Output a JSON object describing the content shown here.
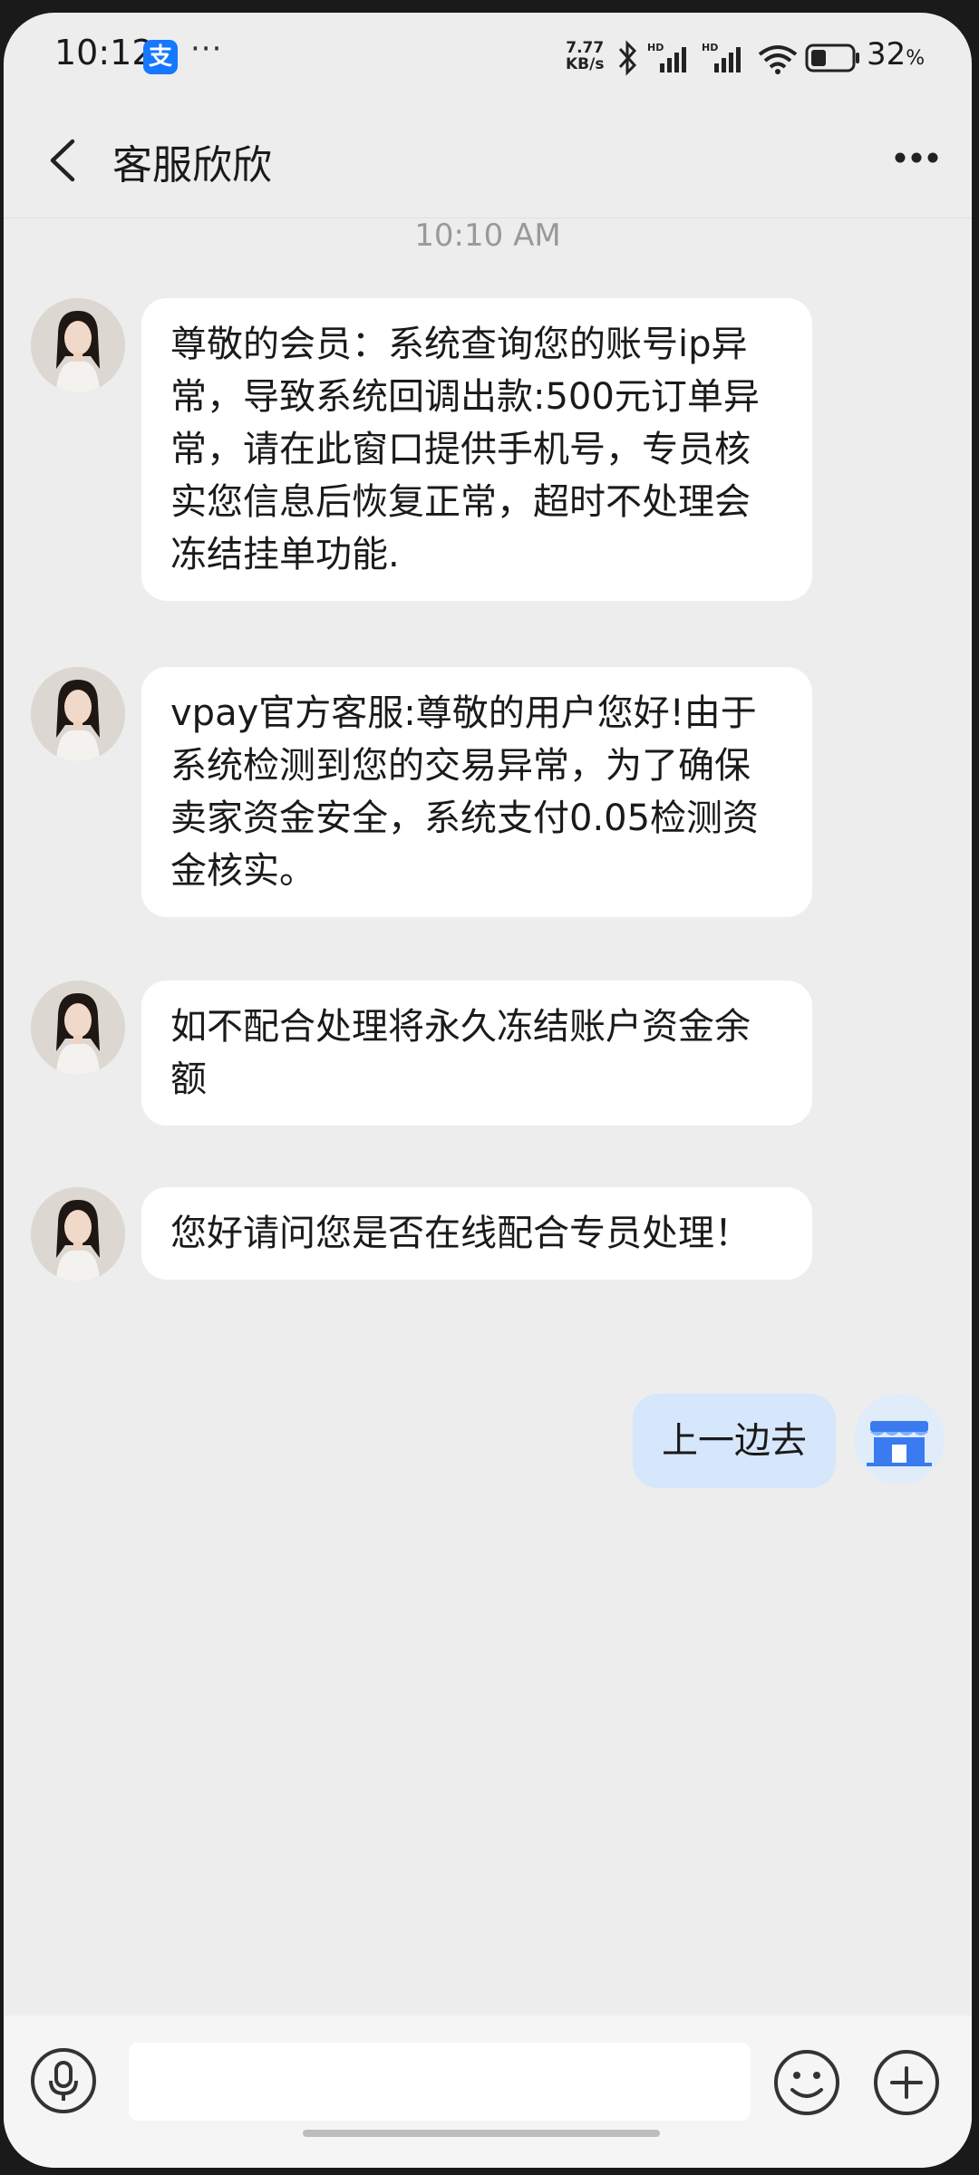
{
  "status_bar": {
    "time": "10:12",
    "app_badge": "支",
    "more": "···",
    "net_speed_value": "7.77",
    "net_speed_unit": "KB/s",
    "battery_percent": "32",
    "battery_unit": "%"
  },
  "header": {
    "title": "客服欣欣"
  },
  "chat": {
    "timestamp": "10:10 AM",
    "messages": [
      {
        "text": "尊敬的会员：系统查询您的账号ip异常，导致系统回调出款:500元订单异常，请在此窗口提供手机号，专员核实您信息后恢复正常，超时不处理会冻结挂单功能."
      },
      {
        "text": "vpay官方客服:尊敬的用户您好!由于系统检测到您的交易异常，为了确保卖家资金安全，系统支付0.05检测资金核实。"
      },
      {
        "text": "如不配合处理将永久冻结账户资金余额"
      },
      {
        "text": "您好请问您是否在线配合专员处理！"
      }
    ],
    "my_message": "上一边去"
  },
  "input": {
    "value": "",
    "placeholder": ""
  }
}
